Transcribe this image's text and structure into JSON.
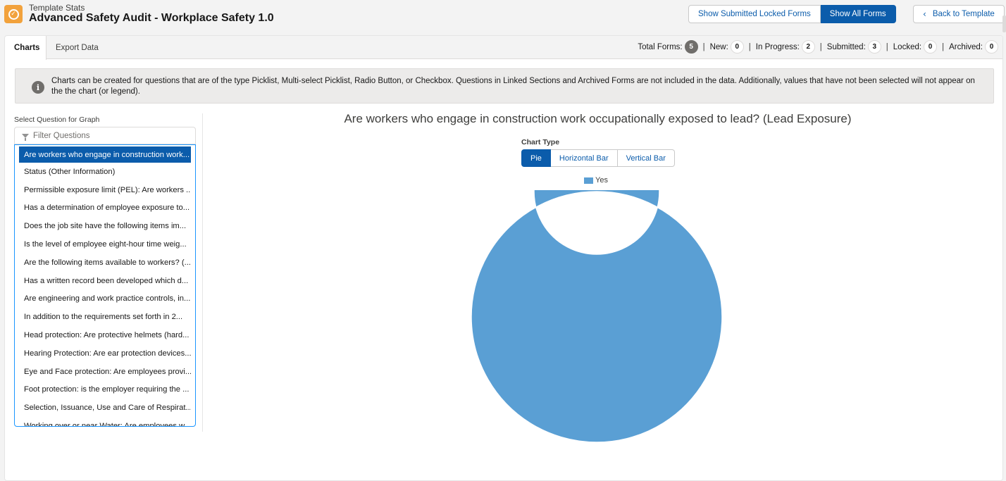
{
  "header": {
    "subtitle": "Template Stats",
    "title": "Advanced Safety Audit - Workplace Safety 1.0",
    "buttons": {
      "locked": "Show Submitted Locked Forms",
      "all": "Show All Forms",
      "back": "Back to Template"
    }
  },
  "tabs": [
    {
      "label": "Charts"
    },
    {
      "label": "Export Data"
    }
  ],
  "stats": [
    {
      "label": "Total Forms:",
      "value": "5"
    },
    {
      "label": "New:",
      "value": "0"
    },
    {
      "label": "In Progress:",
      "value": "2"
    },
    {
      "label": "Submitted:",
      "value": "3"
    },
    {
      "label": "Locked:",
      "value": "0"
    },
    {
      "label": "Archived:",
      "value": "0"
    }
  ],
  "banner": {
    "message": "Charts can be created for questions that are of the type Picklist, Multi-select Picklist, Radio Button, or Checkbox. Questions in Linked Sections and Archived Forms are not included in the data. Additionally, values that have not been selected will not appear on the the chart (or legend)."
  },
  "question_panel": {
    "label": "Select Question for Graph",
    "filter_placeholder": "Filter Questions",
    "questions": [
      "Are workers who engage in construction work...",
      "Status (Other Information)",
      "Permissible exposure limit (PEL): Are workers ...",
      "Has a determination of employee exposure to...",
      "Does the job site have the following items im...",
      "Is the level of employee eight-hour time weig...",
      "Are the following items available to workers? (...",
      "Has a written record been developed which d...",
      "Are engineering and work practice controls, in...",
      "In addition to the requirements set forth in 2...",
      "Head protection: Are protective helmets (hard...",
      "Hearing Protection: Are ear protection devices...",
      "Eye and Face protection: Are employees provi...",
      "Foot protection: is the employer requiring the ...",
      "Selection, Issuance, Use and Care of Respirat...",
      "Working over or near Water: Are employees w..."
    ]
  },
  "chart_panel": {
    "title": "Are workers who engage in construction work occupationally exposed to lead? (Lead Exposure)",
    "chart_type_label": "Chart Type",
    "chart_types": [
      "Pie",
      "Horizontal Bar",
      "Vertical Bar"
    ],
    "active_chart_type": "Pie"
  },
  "colors": {
    "brand": "#0b5cab",
    "slice_yes": "#5a9fd4",
    "app_icon": "#f2a23c"
  },
  "chart_data": {
    "type": "pie",
    "title": "Are workers who engage in construction work occupationally exposed to lead? (Lead Exposure)",
    "donut": true,
    "legend": "top",
    "categories": [
      "Yes"
    ],
    "values": [
      100
    ],
    "colors": [
      "#5a9fd4"
    ]
  }
}
